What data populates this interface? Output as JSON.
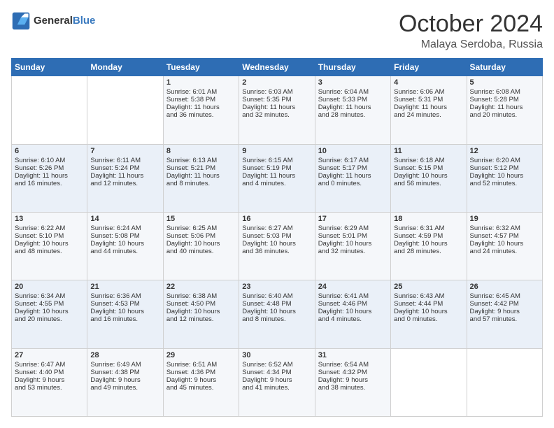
{
  "header": {
    "logo_general": "General",
    "logo_blue": "Blue",
    "month": "October 2024",
    "location": "Malaya Serdoba, Russia"
  },
  "weekdays": [
    "Sunday",
    "Monday",
    "Tuesday",
    "Wednesday",
    "Thursday",
    "Friday",
    "Saturday"
  ],
  "weeks": [
    [
      {
        "day": "",
        "lines": []
      },
      {
        "day": "",
        "lines": []
      },
      {
        "day": "1",
        "lines": [
          "Sunrise: 6:01 AM",
          "Sunset: 5:38 PM",
          "Daylight: 11 hours",
          "and 36 minutes."
        ]
      },
      {
        "day": "2",
        "lines": [
          "Sunrise: 6:03 AM",
          "Sunset: 5:35 PM",
          "Daylight: 11 hours",
          "and 32 minutes."
        ]
      },
      {
        "day": "3",
        "lines": [
          "Sunrise: 6:04 AM",
          "Sunset: 5:33 PM",
          "Daylight: 11 hours",
          "and 28 minutes."
        ]
      },
      {
        "day": "4",
        "lines": [
          "Sunrise: 6:06 AM",
          "Sunset: 5:31 PM",
          "Daylight: 11 hours",
          "and 24 minutes."
        ]
      },
      {
        "day": "5",
        "lines": [
          "Sunrise: 6:08 AM",
          "Sunset: 5:28 PM",
          "Daylight: 11 hours",
          "and 20 minutes."
        ]
      }
    ],
    [
      {
        "day": "6",
        "lines": [
          "Sunrise: 6:10 AM",
          "Sunset: 5:26 PM",
          "Daylight: 11 hours",
          "and 16 minutes."
        ]
      },
      {
        "day": "7",
        "lines": [
          "Sunrise: 6:11 AM",
          "Sunset: 5:24 PM",
          "Daylight: 11 hours",
          "and 12 minutes."
        ]
      },
      {
        "day": "8",
        "lines": [
          "Sunrise: 6:13 AM",
          "Sunset: 5:21 PM",
          "Daylight: 11 hours",
          "and 8 minutes."
        ]
      },
      {
        "day": "9",
        "lines": [
          "Sunrise: 6:15 AM",
          "Sunset: 5:19 PM",
          "Daylight: 11 hours",
          "and 4 minutes."
        ]
      },
      {
        "day": "10",
        "lines": [
          "Sunrise: 6:17 AM",
          "Sunset: 5:17 PM",
          "Daylight: 11 hours",
          "and 0 minutes."
        ]
      },
      {
        "day": "11",
        "lines": [
          "Sunrise: 6:18 AM",
          "Sunset: 5:15 PM",
          "Daylight: 10 hours",
          "and 56 minutes."
        ]
      },
      {
        "day": "12",
        "lines": [
          "Sunrise: 6:20 AM",
          "Sunset: 5:12 PM",
          "Daylight: 10 hours",
          "and 52 minutes."
        ]
      }
    ],
    [
      {
        "day": "13",
        "lines": [
          "Sunrise: 6:22 AM",
          "Sunset: 5:10 PM",
          "Daylight: 10 hours",
          "and 48 minutes."
        ]
      },
      {
        "day": "14",
        "lines": [
          "Sunrise: 6:24 AM",
          "Sunset: 5:08 PM",
          "Daylight: 10 hours",
          "and 44 minutes."
        ]
      },
      {
        "day": "15",
        "lines": [
          "Sunrise: 6:25 AM",
          "Sunset: 5:06 PM",
          "Daylight: 10 hours",
          "and 40 minutes."
        ]
      },
      {
        "day": "16",
        "lines": [
          "Sunrise: 6:27 AM",
          "Sunset: 5:03 PM",
          "Daylight: 10 hours",
          "and 36 minutes."
        ]
      },
      {
        "day": "17",
        "lines": [
          "Sunrise: 6:29 AM",
          "Sunset: 5:01 PM",
          "Daylight: 10 hours",
          "and 32 minutes."
        ]
      },
      {
        "day": "18",
        "lines": [
          "Sunrise: 6:31 AM",
          "Sunset: 4:59 PM",
          "Daylight: 10 hours",
          "and 28 minutes."
        ]
      },
      {
        "day": "19",
        "lines": [
          "Sunrise: 6:32 AM",
          "Sunset: 4:57 PM",
          "Daylight: 10 hours",
          "and 24 minutes."
        ]
      }
    ],
    [
      {
        "day": "20",
        "lines": [
          "Sunrise: 6:34 AM",
          "Sunset: 4:55 PM",
          "Daylight: 10 hours",
          "and 20 minutes."
        ]
      },
      {
        "day": "21",
        "lines": [
          "Sunrise: 6:36 AM",
          "Sunset: 4:53 PM",
          "Daylight: 10 hours",
          "and 16 minutes."
        ]
      },
      {
        "day": "22",
        "lines": [
          "Sunrise: 6:38 AM",
          "Sunset: 4:50 PM",
          "Daylight: 10 hours",
          "and 12 minutes."
        ]
      },
      {
        "day": "23",
        "lines": [
          "Sunrise: 6:40 AM",
          "Sunset: 4:48 PM",
          "Daylight: 10 hours",
          "and 8 minutes."
        ]
      },
      {
        "day": "24",
        "lines": [
          "Sunrise: 6:41 AM",
          "Sunset: 4:46 PM",
          "Daylight: 10 hours",
          "and 4 minutes."
        ]
      },
      {
        "day": "25",
        "lines": [
          "Sunrise: 6:43 AM",
          "Sunset: 4:44 PM",
          "Daylight: 10 hours",
          "and 0 minutes."
        ]
      },
      {
        "day": "26",
        "lines": [
          "Sunrise: 6:45 AM",
          "Sunset: 4:42 PM",
          "Daylight: 9 hours",
          "and 57 minutes."
        ]
      }
    ],
    [
      {
        "day": "27",
        "lines": [
          "Sunrise: 6:47 AM",
          "Sunset: 4:40 PM",
          "Daylight: 9 hours",
          "and 53 minutes."
        ]
      },
      {
        "day": "28",
        "lines": [
          "Sunrise: 6:49 AM",
          "Sunset: 4:38 PM",
          "Daylight: 9 hours",
          "and 49 minutes."
        ]
      },
      {
        "day": "29",
        "lines": [
          "Sunrise: 6:51 AM",
          "Sunset: 4:36 PM",
          "Daylight: 9 hours",
          "and 45 minutes."
        ]
      },
      {
        "day": "30",
        "lines": [
          "Sunrise: 6:52 AM",
          "Sunset: 4:34 PM",
          "Daylight: 9 hours",
          "and 41 minutes."
        ]
      },
      {
        "day": "31",
        "lines": [
          "Sunrise: 6:54 AM",
          "Sunset: 4:32 PM",
          "Daylight: 9 hours",
          "and 38 minutes."
        ]
      },
      {
        "day": "",
        "lines": []
      },
      {
        "day": "",
        "lines": []
      }
    ]
  ]
}
